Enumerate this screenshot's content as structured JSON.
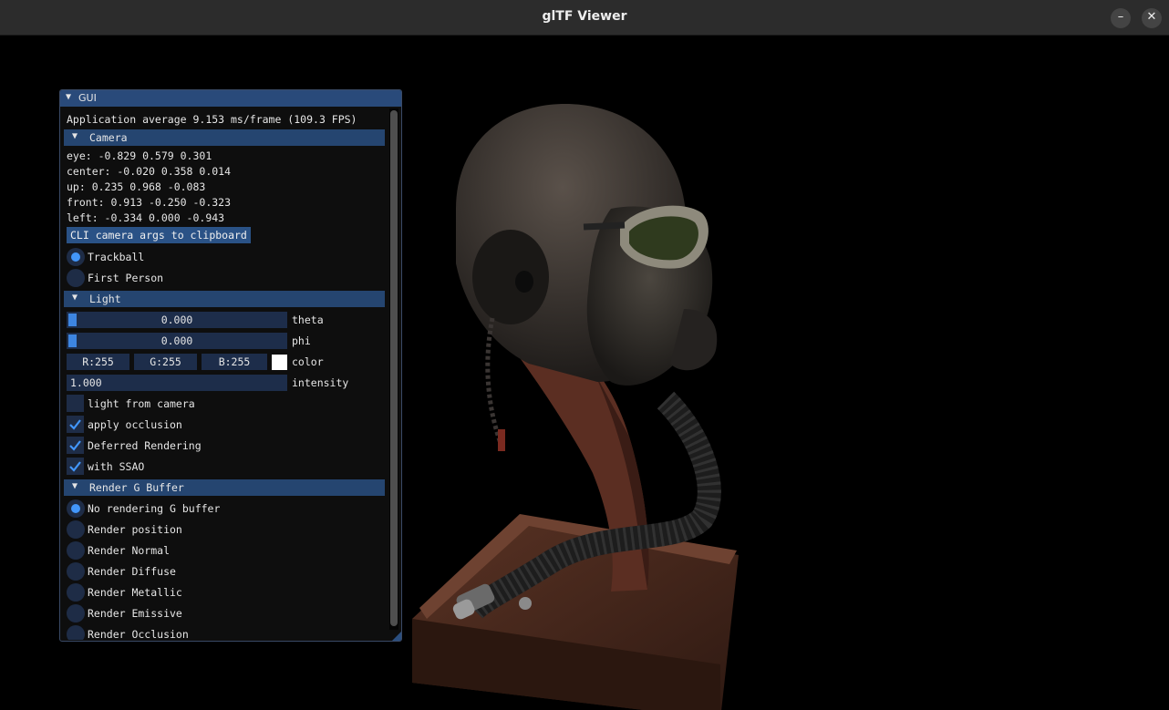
{
  "window": {
    "title": "glTF Viewer",
    "minimize_icon": "–",
    "close_icon": "✕"
  },
  "gui": {
    "title": "GUI",
    "fps_text": "Application average 9.153 ms/frame (109.3 FPS)",
    "camera": {
      "header": "Camera",
      "eye": "eye: -0.829 0.579 0.301",
      "center": "center: -0.020 0.358 0.014",
      "up": "up: 0.235 0.968 -0.083",
      "front": "front: 0.913 -0.250 -0.323",
      "left": "left: -0.334 0.000 -0.943",
      "clipboard_button": "CLI camera args to clipboard",
      "modes": [
        {
          "label": "Trackball",
          "selected": true
        },
        {
          "label": "First Person",
          "selected": false
        }
      ]
    },
    "light": {
      "header": "Light",
      "theta": {
        "value": "0.000",
        "label": "theta",
        "fill": 0
      },
      "phi": {
        "value": "0.000",
        "label": "phi",
        "fill": 0
      },
      "color": {
        "r": "R:255",
        "g": "G:255",
        "b": "B:255",
        "label": "color",
        "swatch": "#ffffff"
      },
      "intensity": {
        "value": "1.000",
        "label": "intensity"
      },
      "light_from_camera": {
        "label": "light from camera",
        "checked": false
      },
      "apply_occlusion": {
        "label": "apply occlusion",
        "checked": true
      },
      "deferred_rendering": {
        "label": "Deferred Rendering",
        "checked": true
      },
      "with_ssao": {
        "label": "with SSAO",
        "checked": true
      }
    },
    "gbuffer": {
      "header": "Render G Buffer",
      "options": [
        {
          "label": "No rendering G buffer",
          "selected": true
        },
        {
          "label": "Render position",
          "selected": false
        },
        {
          "label": "Render Normal",
          "selected": false
        },
        {
          "label": "Render Diffuse",
          "selected": false
        },
        {
          "label": "Render Metallic",
          "selected": false
        },
        {
          "label": "Render Emissive",
          "selected": false
        },
        {
          "label": "Render Occlusion",
          "selected": false
        }
      ]
    }
  },
  "colors": {
    "accent": "#4296fa",
    "header": "#254570",
    "title_bar": "#294a7a",
    "frame": "#1d2d4a"
  }
}
